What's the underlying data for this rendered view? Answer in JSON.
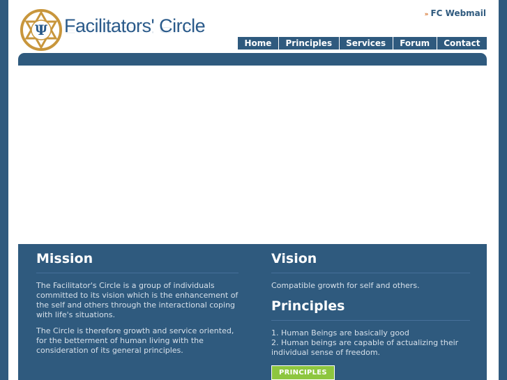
{
  "header": {
    "logo_text": "Facilitators' Circle",
    "logo_symbol": "Ψ",
    "webmail_link": "FC Webmail"
  },
  "nav": {
    "items": [
      "Home",
      "Principles",
      "Services",
      "Forum",
      "Contact"
    ]
  },
  "mission": {
    "title": "Mission",
    "para1": "The Facilitator's Circle is a group of individuals committed to its vision which is the enhancement of the self and others through the interactional coping with life's situations.",
    "para2": "The Circle is therefore growth and service oriented, for the betterment of human living with the consideration of its general principles."
  },
  "vision": {
    "title": "Vision",
    "text": "Compatible growth for self and others."
  },
  "principles": {
    "title": "Principles",
    "item1": "1. Human Beings are basically good",
    "item2": "2. Human beings are capable of actualizing their individual sense of freedom.",
    "button_label": "PRINCIPLES"
  },
  "colors": {
    "brand_blue": "#2f5a7e",
    "accent_green": "#8dc63f",
    "logo_gold": "#c8963c"
  }
}
